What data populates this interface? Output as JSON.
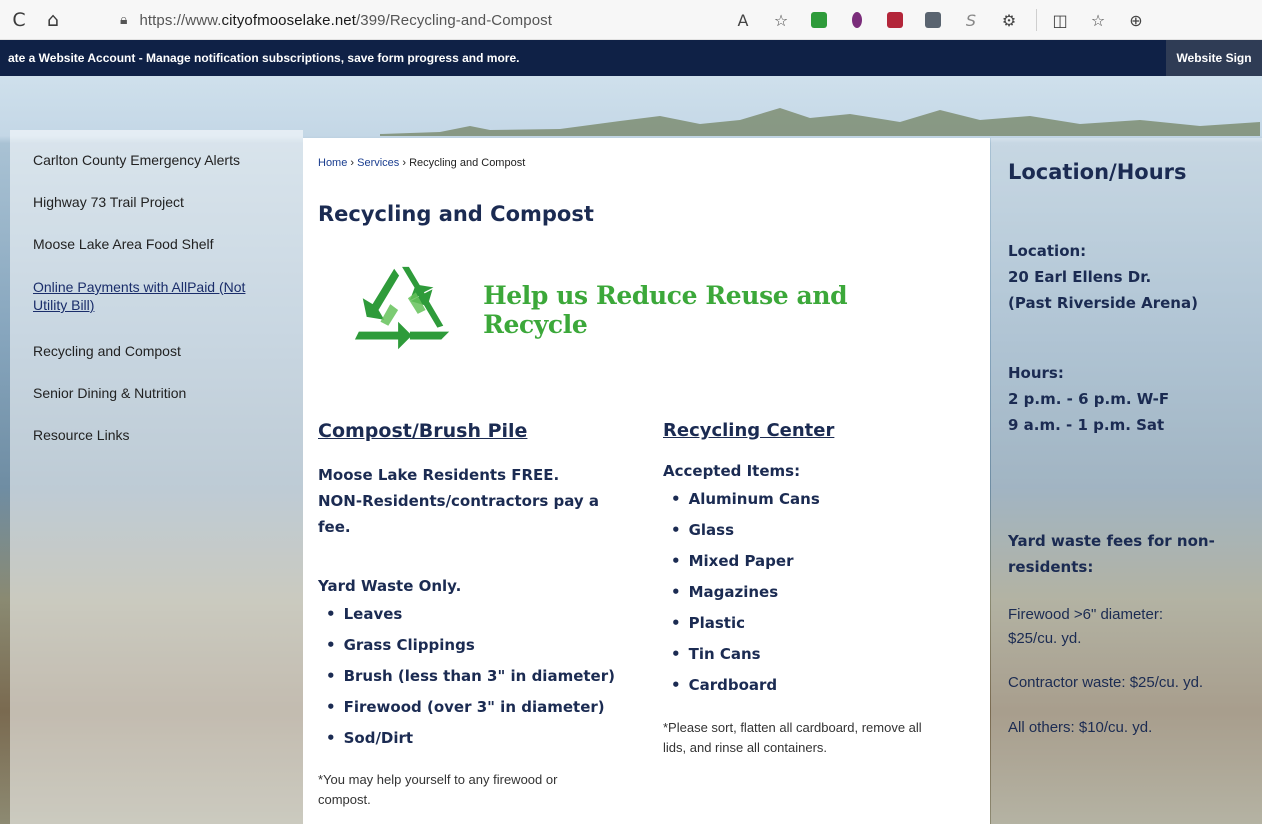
{
  "browser": {
    "url_prefix": "https://www.",
    "url_domain": "cityofmooselake.net",
    "url_path": "/399/Recycling-and-Compost",
    "reload_glyph": "C",
    "home_glyph": "⌂",
    "lock_glyph": "🔒",
    "read_aloud_glyph": "A",
    "favorite_glyph": "☆",
    "ext_s_glyph": "S",
    "extensions_glyph": "⚙",
    "split_glyph": "◫",
    "favorites_glyph": "☆",
    "collections_glyph": "⊕"
  },
  "banner": {
    "text_bold": "ate a Website Account",
    "text_rest": " - Manage notification subscriptions, save form progress and more.",
    "sign_in": "Website Sign"
  },
  "sidebar": {
    "items": [
      {
        "label": "Carlton County Emergency Alerts"
      },
      {
        "label": "Highway 73 Trail Project"
      },
      {
        "label": "Moose Lake Area Food Shelf"
      },
      {
        "label": "Online Payments with AllPaid (Not Utility Bill)"
      },
      {
        "label": "Recycling and Compost"
      },
      {
        "label": "Senior Dining & Nutrition"
      },
      {
        "label": "Resource Links"
      }
    ]
  },
  "breadcrumb": {
    "home": "Home",
    "sep": " › ",
    "services": "Services",
    "current": "Recycling and Compost"
  },
  "main": {
    "title": "Recycling and Compost",
    "tagline": "Help us Reduce Reuse and Recycle",
    "compost": {
      "heading": "Compost/Brush Pile",
      "intro_line1": "Moose Lake Residents FREE.",
      "intro_line2": "NON-Residents/contractors pay a",
      "intro_line3": "fee.",
      "yard_label": "Yard Waste Only.",
      "items": [
        "Leaves",
        "Grass Clippings",
        "Brush (less than 3\" in diameter)",
        "Firewood (over 3\" in diameter)",
        "Sod/Dirt"
      ],
      "note_line1": "*You may help yourself to any firewood or",
      "note_line2": "compost."
    },
    "recycling": {
      "heading": "Recycling Center",
      "accepted_label": "Accepted Items:",
      "items": [
        "Aluminum Cans",
        "Glass",
        "Mixed Paper",
        "Magazines",
        "Plastic",
        "Tin Cans",
        "Cardboard"
      ],
      "note_line1": "*Please sort, flatten all cardboard, remove all",
      "note_line2": "lids, and rinse all containers."
    }
  },
  "location": {
    "title": "Location/Hours",
    "location_label": "Location:",
    "address_line1": "20 Earl Ellens Dr.",
    "address_line2": "(Past Riverside Arena)",
    "hours_label": "Hours:",
    "hours_line1": "2 p.m. - 6 p.m. W-F",
    "hours_line2": "9 a.m. - 1 p.m. Sat",
    "fees_label_line1": "Yard waste fees for non-",
    "fees_label_line2": "residents:",
    "firewood_line1": "Firewood >6\" diameter:",
    "firewood_line2": "$25/cu. yd.",
    "contractor": "Contractor waste: $25/cu. yd.",
    "others": "All others: $10/cu. yd."
  },
  "colors": {
    "banner_bg": "#0f2146",
    "heading_navy": "#1b2b52",
    "tagline_green": "#3ca83a"
  }
}
